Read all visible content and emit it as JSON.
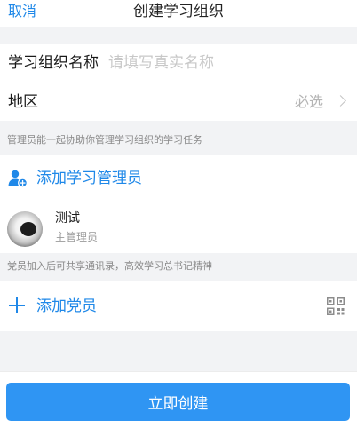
{
  "nav": {
    "cancel_label": "取消",
    "title": "创建学习组织"
  },
  "form": {
    "name_label": "学习组织名称",
    "name_placeholder": "请填写真实名称",
    "name_value": "",
    "region_label": "地区",
    "region_value": "必选"
  },
  "admins": {
    "hint": "管理员能一起协助你管理学习组织的学习任务",
    "add_label": "添加学习管理员",
    "list": [
      {
        "name": "测试",
        "role": "主管理员"
      }
    ]
  },
  "members": {
    "hint": "党员加入后可共享通讯录，高效学习总书记精神",
    "add_label": "添加党员"
  },
  "footer": {
    "create_label": "立即创建"
  },
  "icons": {
    "add_admin": "user-add-icon",
    "add_member": "plus-icon",
    "qr": "qr-code-icon",
    "chevron": "chevron-right-icon"
  },
  "colors": {
    "accent": "#1f88e8",
    "button": "#2f95f3",
    "background": "#f2f3f5"
  }
}
